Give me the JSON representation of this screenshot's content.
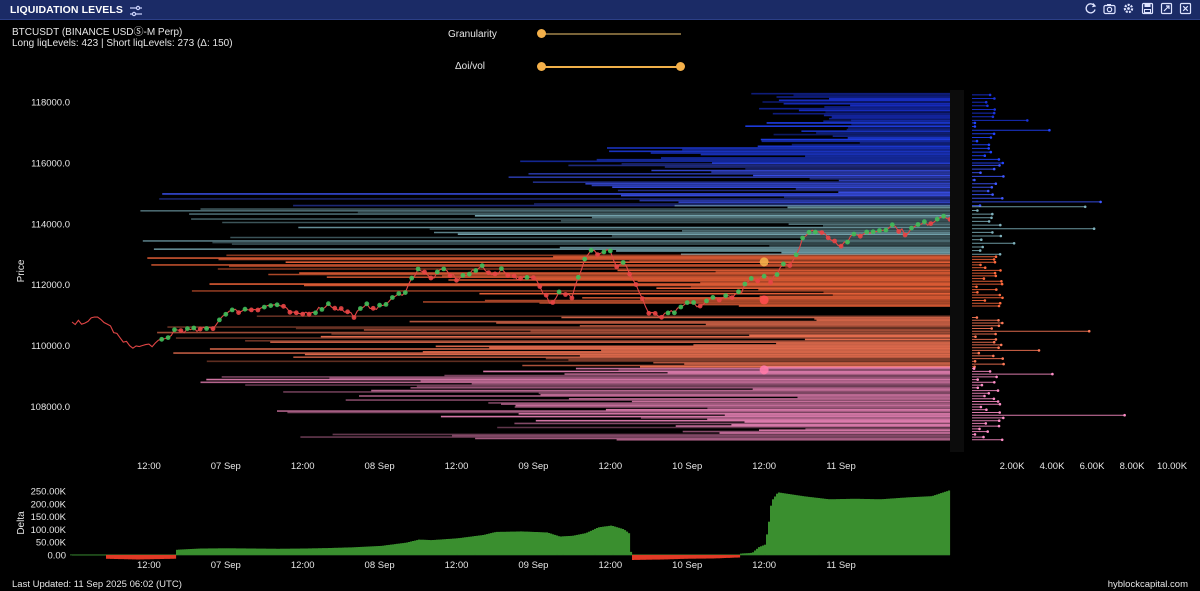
{
  "window": {
    "title": "LIQUIDATION LEVELS",
    "accent": "#1b2b66",
    "tools": [
      "refresh-icon",
      "camera-icon",
      "gear-icon",
      "save-icon",
      "expand-icon",
      "close-icon"
    ]
  },
  "info": {
    "symbol": "BTCUSDT (BINANCE USDⓈ-M Perp)",
    "levels": "Long liqLevels: 423 | Short liqLevels: 273 (Δ: 150)"
  },
  "controls": {
    "granularity_label": "Granularity",
    "granularity_value": 0.0,
    "oivol_label": "Δoi/vol",
    "oivol_range": [
      0.0,
      1.0
    ],
    "color": "#f4b04a"
  },
  "footer": {
    "last_updated": "Last Updated: 11 Sep 2025 06:02 (UTC)",
    "brand": "hyblockcapital.com"
  },
  "chart_data": [
    {
      "type": "line",
      "ylabel": "Price",
      "ylim": [
        106500,
        118400
      ],
      "yticks": [
        "118000.0",
        "116000.0",
        "114000.0",
        "112000.0",
        "110000.0",
        "108000.0"
      ],
      "ytick_values": [
        118000,
        116000,
        114000,
        112000,
        110000,
        108000
      ],
      "xticks": [
        "12:00",
        "07 Sep",
        "12:00",
        "08 Sep",
        "12:00",
        "09 Sep",
        "12:00",
        "10 Sep",
        "12:00",
        "11 Sep"
      ],
      "xtick_hours": [
        12,
        24,
        36,
        48,
        60,
        72,
        84,
        96,
        108,
        120
      ],
      "hours_range": [
        0,
        137
      ],
      "price_series": {
        "hours": [
          0,
          4,
          5,
          6,
          8,
          10,
          13,
          15,
          16,
          20,
          22,
          24,
          28,
          32,
          34,
          35,
          38,
          40,
          44,
          46,
          48,
          52,
          54,
          56,
          58,
          60,
          62,
          64,
          66,
          67,
          70,
          72,
          74,
          75,
          76,
          78,
          80,
          81,
          82,
          84,
          85,
          86,
          87,
          88,
          90,
          92,
          95,
          96,
          98,
          100,
          102,
          104,
          105,
          106,
          107,
          108,
          109,
          110,
          111,
          112,
          113,
          114,
          116,
          118,
          120,
          122,
          124,
          126,
          128,
          130,
          132,
          134,
          136,
          137
        ],
        "values": [
          110700,
          110900,
          110800,
          110600,
          110100,
          109950,
          110050,
          110250,
          110500,
          110500,
          110600,
          111100,
          111200,
          111350,
          111100,
          111000,
          111150,
          111350,
          111000,
          111300,
          111250,
          111800,
          112550,
          112200,
          112500,
          112200,
          112350,
          112600,
          112300,
          112450,
          112200,
          112300,
          111600,
          111350,
          111700,
          111600,
          112900,
          113200,
          113050,
          113150,
          112550,
          112700,
          112400,
          112000,
          111050,
          110950,
          111200,
          111400,
          111300,
          111550,
          111600,
          111700,
          111950,
          112200,
          112050,
          112350,
          112100,
          112400,
          112750,
          112650,
          113000,
          113550,
          113800,
          113600,
          113300,
          113600,
          113700,
          113800,
          113950,
          113700,
          113950,
          114050,
          114300,
          114200
        ]
      },
      "liquidation_bands": [
        {
          "side": "short",
          "from": 117400,
          "to": 118300,
          "color": "#1a33dd"
        },
        {
          "side": "short",
          "from": 116000,
          "to": 117400,
          "color": "#2244ff"
        },
        {
          "side": "short",
          "from": 114600,
          "to": 116000,
          "color": "#3f57ff"
        },
        {
          "side": "short",
          "from": 113000,
          "to": 114600,
          "color": "#7fb2bd"
        },
        {
          "side": "long",
          "from": 111300,
          "to": 113000,
          "color": "#ff6a3d"
        },
        {
          "side": "long",
          "from": 109300,
          "to": 111000,
          "color": "#ff7a58"
        },
        {
          "side": "long",
          "from": 106900,
          "to": 109300,
          "color": "#ff8fc8"
        }
      ],
      "heatmap_xlim": [
        0,
        10000
      ],
      "heatmap_xticks": [
        "2.00K",
        "4.00K",
        "6.00K",
        "8.00K",
        "10.00K"
      ],
      "heatmap_xtick_values": [
        2000,
        4000,
        6000,
        8000,
        10000
      ],
      "markers": [
        {
          "hour": 108,
          "price": 112750,
          "color": "#f4b04a"
        },
        {
          "hour": 108,
          "price": 111500,
          "color": "#ff4d4d"
        },
        {
          "hour": 108,
          "price": 109200,
          "color": "#ff7aa8"
        }
      ]
    },
    {
      "type": "area",
      "ylabel": "Delta",
      "ylim": [
        -20000,
        270000
      ],
      "yticks": [
        "250.00K",
        "200.00K",
        "150.00K",
        "100.00K",
        "50.00K",
        "0.00"
      ],
      "ytick_values": [
        250000,
        200000,
        150000,
        100000,
        50000,
        0
      ],
      "xticks": [
        "12:00",
        "07 Sep",
        "12:00",
        "08 Sep",
        "12:00",
        "09 Sep",
        "12:00",
        "10 Sep",
        "12:00",
        "11 Sep"
      ],
      "xtick_hours": [
        12,
        24,
        36,
        48,
        60,
        72,
        84,
        96,
        108,
        120
      ],
      "hours": [
        0,
        5,
        5.1,
        10,
        16,
        16.1,
        20,
        24,
        28,
        32,
        36,
        40,
        44,
        48,
        52,
        54,
        56,
        60,
        64,
        66,
        70,
        72,
        74,
        76,
        78,
        80,
        82,
        84,
        86,
        87,
        87.1,
        92,
        96,
        100,
        104,
        104.1,
        106,
        107,
        108,
        108.5,
        109,
        110,
        114,
        118,
        122,
        126,
        130,
        134,
        137
      ],
      "values": [
        0,
        0,
        -15000,
        -18000,
        -15000,
        20000,
        25000,
        26000,
        25000,
        24000,
        25000,
        27000,
        30000,
        35000,
        48000,
        60000,
        58000,
        65000,
        78000,
        90000,
        92000,
        90000,
        88000,
        72000,
        75000,
        85000,
        108000,
        115000,
        100000,
        80000,
        -20000,
        -18000,
        -15000,
        -14000,
        -10000,
        5000,
        8000,
        30000,
        40000,
        110000,
        210000,
        245000,
        230000,
        218000,
        220000,
        218000,
        225000,
        230000,
        255000
      ],
      "colors": {
        "positive": "#3a8f2f",
        "negative": "#e13a25"
      }
    }
  ]
}
